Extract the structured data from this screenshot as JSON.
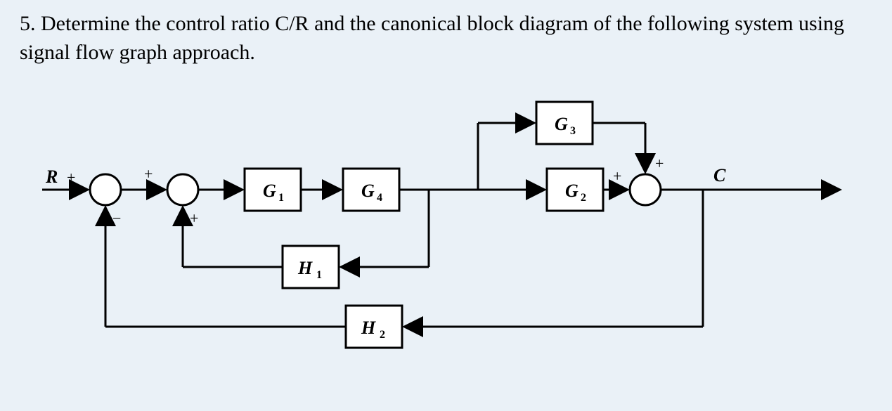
{
  "question": "5. Determine the control ratio C/R and the canonical block diagram of the following system using signal flow graph approach.",
  "io": {
    "input": "R",
    "output": "C"
  },
  "blocks": {
    "G1": {
      "base": "G",
      "sub": "1"
    },
    "G2": {
      "base": "G",
      "sub": "2"
    },
    "G3": {
      "base": "G",
      "sub": "3"
    },
    "G4": {
      "base": "G",
      "sub": "4"
    },
    "H1": {
      "base": "H",
      "sub": "1"
    },
    "H2": {
      "base": "H",
      "sub": "2"
    }
  },
  "summers": {
    "s1": {
      "top": "+",
      "bottom": "−"
    },
    "s2": {
      "top": "+",
      "bottom": "+"
    },
    "s3": {
      "top": "+",
      "side": "+"
    }
  },
  "chart_data": {
    "type": "table",
    "description": "Block diagram / signal flow structure. Nodes: R (input), S1 (summing), S2 (summing), G1, G4, pickoff P1, G3, G2, S3 (summing), pickoff P2, C (output). Feedback blocks H1 (from P1 to S2, positive) and H2 (from P2 to S1, negative). Feedforward block G3 (from P1 to S3, positive).",
    "nodes": [
      {
        "id": "R",
        "type": "input"
      },
      {
        "id": "S1",
        "type": "summer",
        "signs": {
          "in_main": "+",
          "in_feedback": "-"
        }
      },
      {
        "id": "S2",
        "type": "summer",
        "signs": {
          "in_main": "+",
          "in_feedback": "+"
        }
      },
      {
        "id": "G1",
        "type": "block",
        "gain": "G1"
      },
      {
        "id": "G4",
        "type": "block",
        "gain": "G4"
      },
      {
        "id": "P1",
        "type": "pickoff"
      },
      {
        "id": "G3",
        "type": "block",
        "gain": "G3"
      },
      {
        "id": "G2",
        "type": "block",
        "gain": "G2"
      },
      {
        "id": "S3",
        "type": "summer",
        "signs": {
          "in_main": "+",
          "in_feedforward": "+"
        }
      },
      {
        "id": "P2",
        "type": "pickoff"
      },
      {
        "id": "C",
        "type": "output"
      },
      {
        "id": "H1",
        "type": "block",
        "gain": "H1"
      },
      {
        "id": "H2",
        "type": "block",
        "gain": "H2"
      }
    ],
    "edges": [
      {
        "from": "R",
        "to": "S1"
      },
      {
        "from": "S1",
        "to": "S2"
      },
      {
        "from": "S2",
        "to": "G1"
      },
      {
        "from": "G1",
        "to": "G4"
      },
      {
        "from": "G4",
        "to": "P1"
      },
      {
        "from": "P1",
        "to": "G2"
      },
      {
        "from": "P1",
        "to": "G3"
      },
      {
        "from": "G2",
        "to": "S3"
      },
      {
        "from": "G3",
        "to": "S3"
      },
      {
        "from": "S3",
        "to": "P2"
      },
      {
        "from": "P2",
        "to": "C"
      },
      {
        "from": "P1",
        "to": "H1"
      },
      {
        "from": "H1",
        "to": "S2"
      },
      {
        "from": "P2",
        "to": "H2"
      },
      {
        "from": "H2",
        "to": "S1"
      }
    ]
  }
}
